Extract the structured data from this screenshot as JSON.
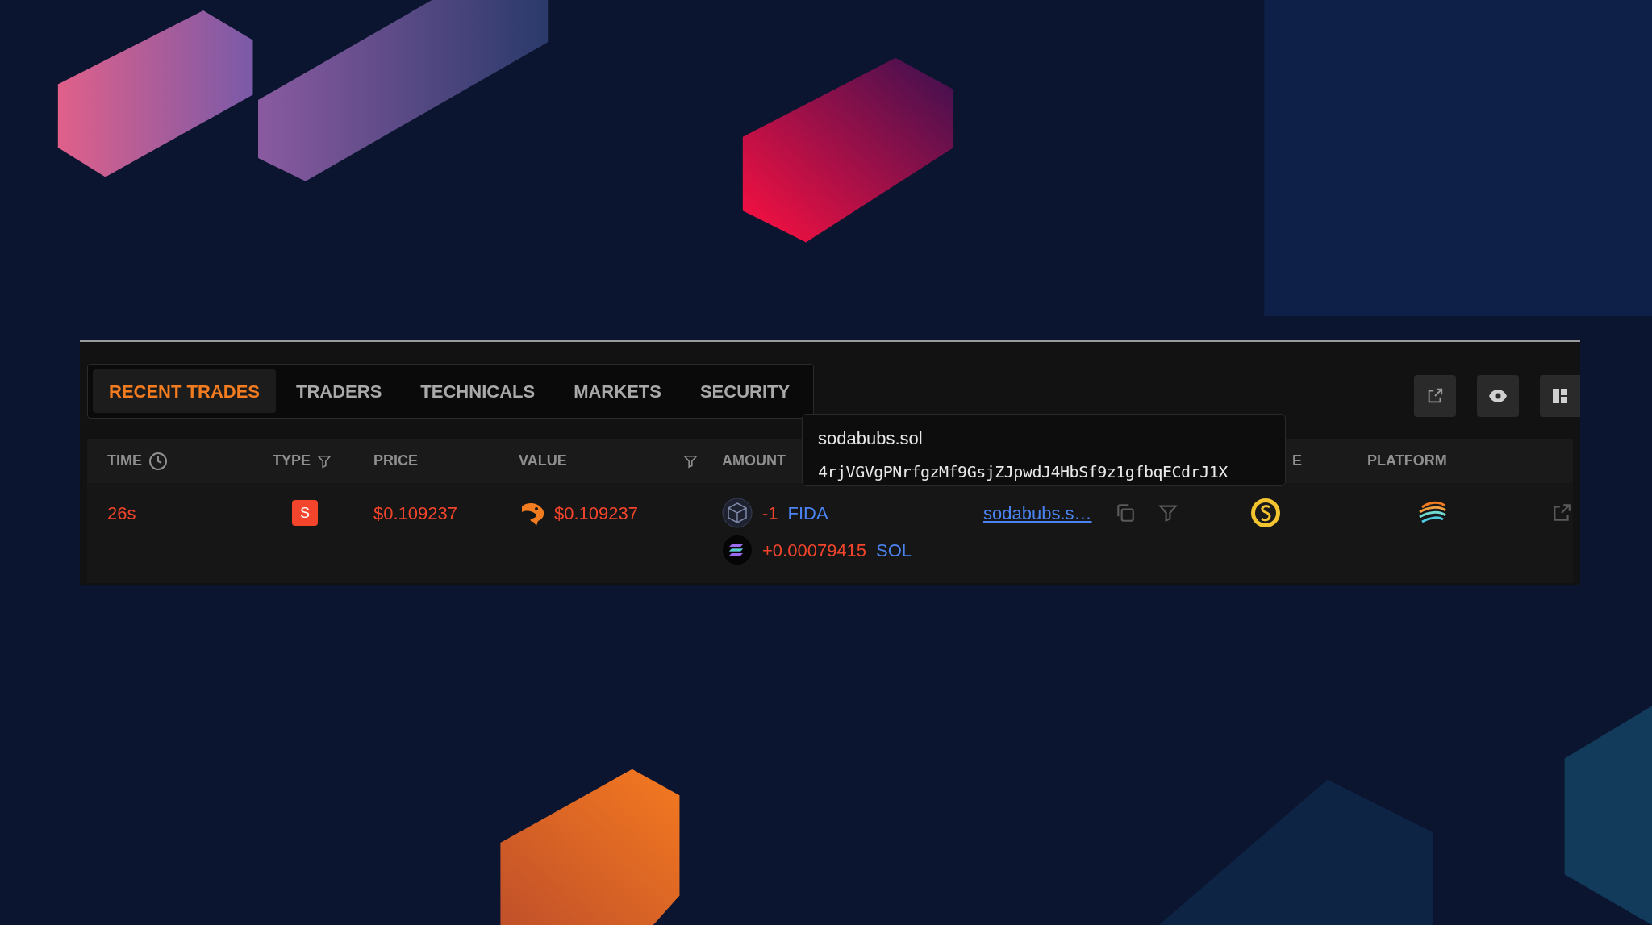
{
  "tabs": [
    {
      "label": "RECENT TRADES",
      "selected": true
    },
    {
      "label": "TRADERS",
      "selected": false
    },
    {
      "label": "TECHNICALS",
      "selected": false
    },
    {
      "label": "MARKETS",
      "selected": false
    },
    {
      "label": "SECURITY",
      "selected": false
    }
  ],
  "table": {
    "columns": [
      {
        "label": "TIME"
      },
      {
        "label": "TYPE"
      },
      {
        "label": "PRICE"
      },
      {
        "label": "VALUE"
      },
      {
        "label": "AMOUNT"
      },
      {
        "label": "E"
      },
      {
        "label": "PLATFORM"
      }
    ],
    "rows": [
      {
        "time": "26s",
        "type": "S",
        "price": "$0.109237",
        "value": "$0.109237",
        "amounts": [
          {
            "kind": "cube",
            "amount": "-1",
            "symbol": "FIDA"
          },
          {
            "kind": "coin",
            "amount": "+0.00079415",
            "symbol": "SOL"
          }
        ],
        "maker": "sodabubs.s…"
      }
    ]
  },
  "tooltip": {
    "title": "sodabubs.sol",
    "address": "4rjVGVgPNrfgzMf9GsjZJpwdJ4HbSf9z1gfbqECdrJ1X"
  }
}
